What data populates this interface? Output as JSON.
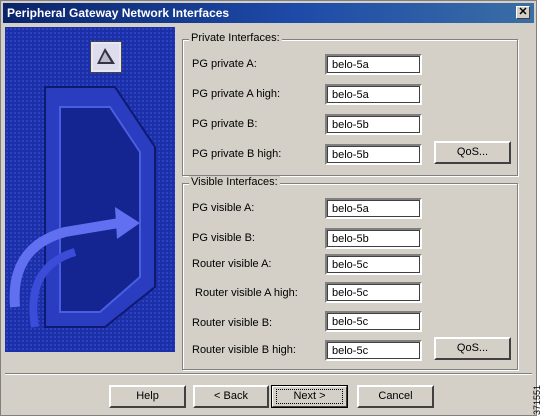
{
  "window": {
    "title": "Peripheral Gateway Network Interfaces"
  },
  "private": {
    "legend": "Private Interfaces:",
    "fields": [
      {
        "label": "PG private A:",
        "value": "belo-5a"
      },
      {
        "label": "PG private A high:",
        "value": "belo-5a"
      },
      {
        "label": "PG private B:",
        "value": "belo-5b"
      },
      {
        "label": "PG private B high:",
        "value": "belo-5b"
      }
    ],
    "qos_label": "QoS..."
  },
  "visible": {
    "legend": "Visible Interfaces:",
    "fields": [
      {
        "label": "PG visible A:",
        "value": "belo-5a"
      },
      {
        "label": "PG visible B:",
        "value": "belo-5b"
      },
      {
        "label": "Router visible A:",
        "value": "belo-5c"
      },
      {
        "label": " Router visible A high:",
        "value": "belo-5c"
      },
      {
        "label": "Router visible B:",
        "value": "belo-5c"
      },
      {
        "label": "Router visible B high:",
        "value": "belo-5c"
      }
    ],
    "qos_label": "QoS..."
  },
  "buttons": {
    "help": "Help",
    "back": "< Back",
    "next": "Next >",
    "cancel": "Cancel"
  },
  "figure_id": "371551",
  "colors": {
    "titlebar": "#0a246a",
    "dialog": "#d4d0c8",
    "graphic": "#1b2fa8"
  }
}
